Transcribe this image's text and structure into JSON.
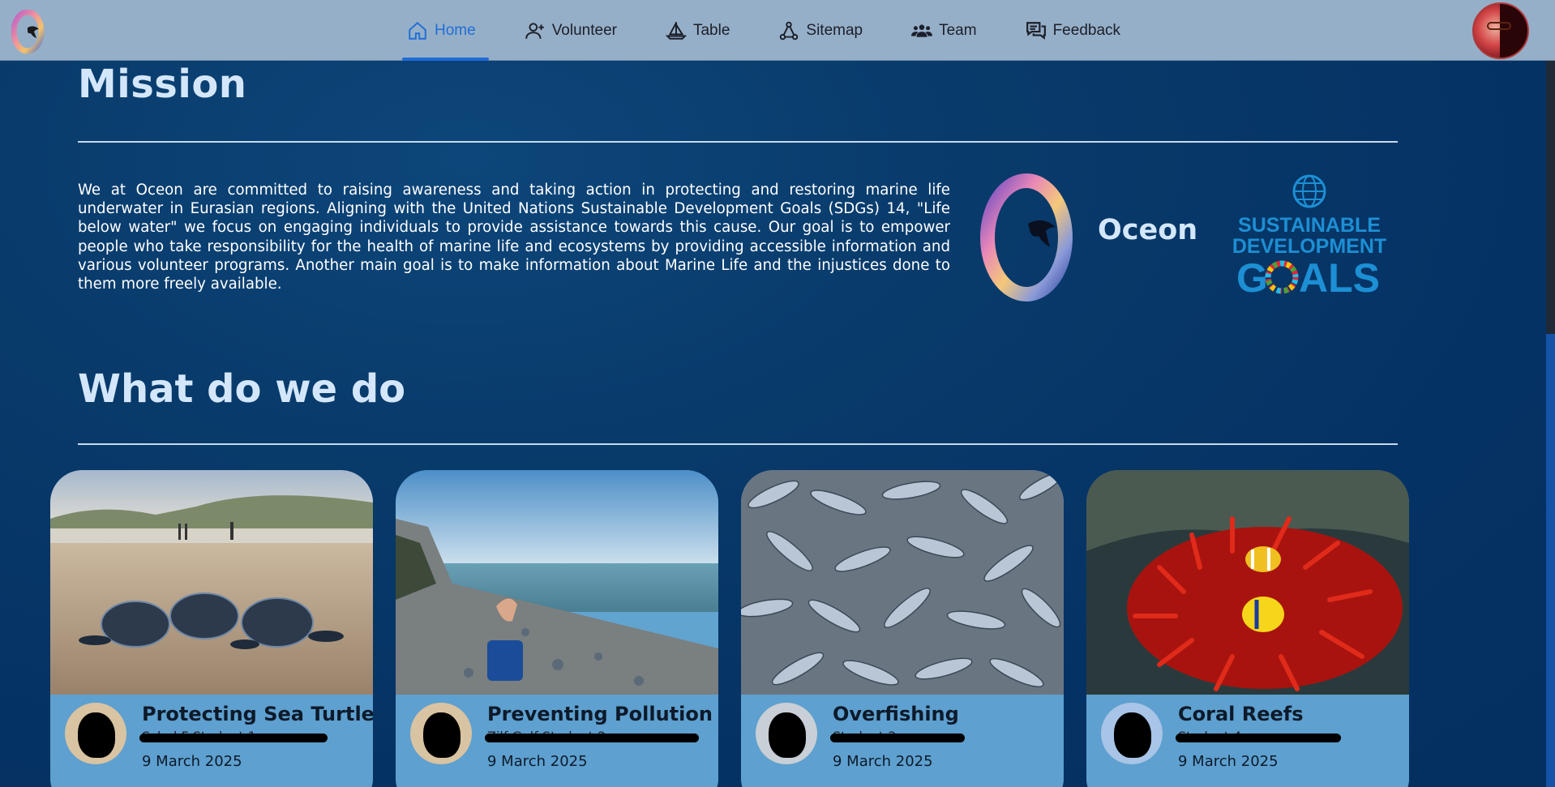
{
  "nav": {
    "items": [
      {
        "label": "Home",
        "icon": "home-icon",
        "active": true
      },
      {
        "label": "Volunteer",
        "icon": "add-user-icon",
        "active": false
      },
      {
        "label": "Table",
        "icon": "sailboat-icon",
        "active": false
      },
      {
        "label": "Sitemap",
        "icon": "sitemap-icon",
        "active": false
      },
      {
        "label": "Team",
        "icon": "team-icon",
        "active": false
      },
      {
        "label": "Feedback",
        "icon": "feedback-icon",
        "active": false
      }
    ]
  },
  "mission": {
    "heading": "Mission",
    "text": "We at Oceon are committed to raising awareness and taking action in protecting and restoring marine life underwater in Eurasian regions. Aligning with the United Nations Sustainable Development Goals (SDGs) 14, \"Life below water\" we focus on engaging individuals to provide assistance towards this cause. Our goal is to empower people who take responsibility for the health of marine life and ecosystems by providing accessible information and various volunteer programs. Another main goal is to make information about Marine Life and the injustices done to them more freely available.",
    "brand_name": "Oceon",
    "sdg_line1": "SUSTAINABLE",
    "sdg_line2": "DEVELOPMENT",
    "sdg_line3a": "G",
    "sdg_line3b": "ALS"
  },
  "what": {
    "heading": "What do we do",
    "cards": [
      {
        "title": "Protecting Sea Turtles",
        "author": "Schal F Student 1",
        "date": "9 March 2025"
      },
      {
        "title": "Preventing Pollution",
        "author": "Zilf Golf Student 2",
        "date": "9 March 2025"
      },
      {
        "title": "Overfishing",
        "author": "Student 3",
        "date": "9 March 2025"
      },
      {
        "title": "Coral Reefs",
        "author": "Student 4",
        "date": "9 March 2025"
      }
    ]
  },
  "colors": {
    "background": "#053264",
    "navbar": "#96afc8",
    "accent": "#1f6ed6",
    "card": "#5ea0cf",
    "heading": "#d4e7fa"
  }
}
